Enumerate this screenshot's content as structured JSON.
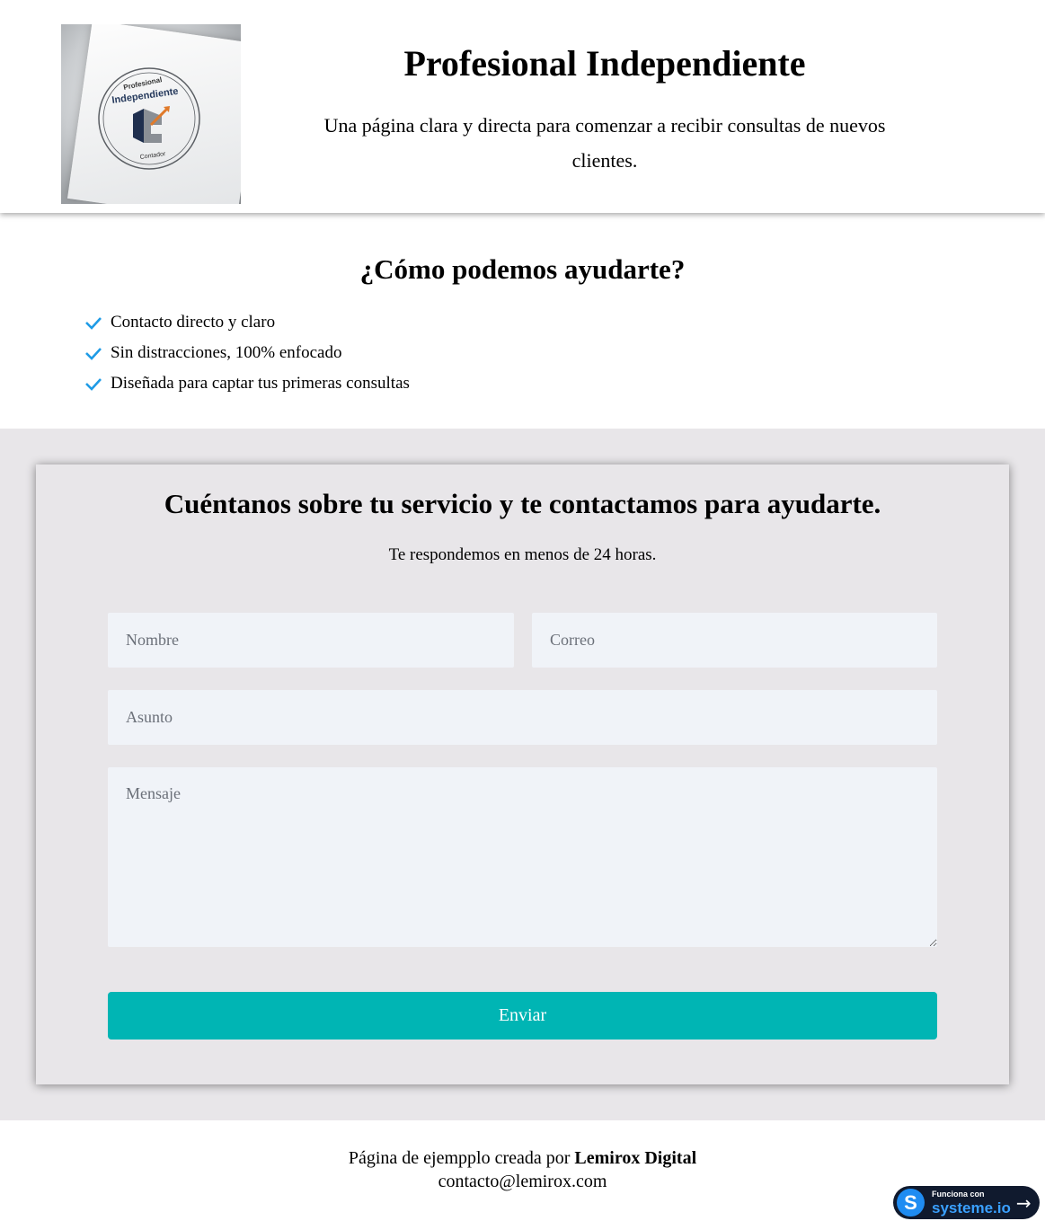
{
  "header": {
    "logo": {
      "alt": "Profesional Independiente Contador logo",
      "text_top": "Profesional",
      "text_main": "Independiente",
      "text_bottom": "Contador"
    },
    "title": "Profesional Independiente",
    "subtitle": "Una página clara y directa para comenzar a recibir consultas de nuevos clientes."
  },
  "help": {
    "title": "¿Cómo podemos ayudarte?",
    "check_color": "#1e9be6",
    "items": [
      "Contacto directo y claro",
      "Sin distracciones, 100% enfocado",
      "Diseñada para captar tus primeras consultas"
    ]
  },
  "form": {
    "title": "Cuéntanos sobre tu servicio y te contactamos para ayudarte.",
    "subtitle": "Te respondemos en menos de 24 horas.",
    "name_placeholder": "Nombre",
    "email_placeholder": "Correo",
    "subject_placeholder": "Asunto",
    "message_placeholder": "Mensaje",
    "submit_label": "Enviar",
    "submit_color": "#00b5b4"
  },
  "footer": {
    "credit_prefix": "Página de ejempplo creada por",
    "credit_brand": "Lemirox Digital",
    "email": "contacto@lemirox.com"
  },
  "badge": {
    "small_text": "Funciona con",
    "brand": "systeme.io",
    "logo_letter": "S",
    "arrow_icon": "arrow-right-icon"
  }
}
